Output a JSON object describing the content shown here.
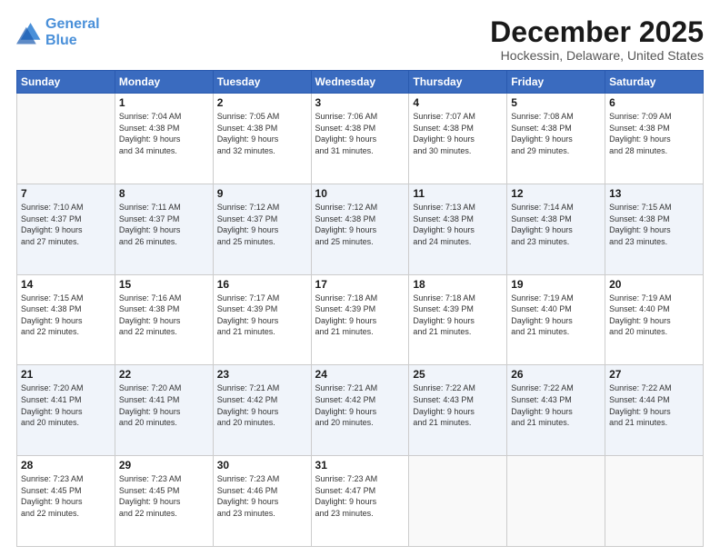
{
  "logo": {
    "line1": "General",
    "line2": "Blue"
  },
  "title": "December 2025",
  "subtitle": "Hockessin, Delaware, United States",
  "days_header": [
    "Sunday",
    "Monday",
    "Tuesday",
    "Wednesday",
    "Thursday",
    "Friday",
    "Saturday"
  ],
  "weeks": [
    [
      {
        "num": "",
        "info": ""
      },
      {
        "num": "1",
        "info": "Sunrise: 7:04 AM\nSunset: 4:38 PM\nDaylight: 9 hours\nand 34 minutes."
      },
      {
        "num": "2",
        "info": "Sunrise: 7:05 AM\nSunset: 4:38 PM\nDaylight: 9 hours\nand 32 minutes."
      },
      {
        "num": "3",
        "info": "Sunrise: 7:06 AM\nSunset: 4:38 PM\nDaylight: 9 hours\nand 31 minutes."
      },
      {
        "num": "4",
        "info": "Sunrise: 7:07 AM\nSunset: 4:38 PM\nDaylight: 9 hours\nand 30 minutes."
      },
      {
        "num": "5",
        "info": "Sunrise: 7:08 AM\nSunset: 4:38 PM\nDaylight: 9 hours\nand 29 minutes."
      },
      {
        "num": "6",
        "info": "Sunrise: 7:09 AM\nSunset: 4:38 PM\nDaylight: 9 hours\nand 28 minutes."
      }
    ],
    [
      {
        "num": "7",
        "info": "Sunrise: 7:10 AM\nSunset: 4:37 PM\nDaylight: 9 hours\nand 27 minutes."
      },
      {
        "num": "8",
        "info": "Sunrise: 7:11 AM\nSunset: 4:37 PM\nDaylight: 9 hours\nand 26 minutes."
      },
      {
        "num": "9",
        "info": "Sunrise: 7:12 AM\nSunset: 4:37 PM\nDaylight: 9 hours\nand 25 minutes."
      },
      {
        "num": "10",
        "info": "Sunrise: 7:12 AM\nSunset: 4:38 PM\nDaylight: 9 hours\nand 25 minutes."
      },
      {
        "num": "11",
        "info": "Sunrise: 7:13 AM\nSunset: 4:38 PM\nDaylight: 9 hours\nand 24 minutes."
      },
      {
        "num": "12",
        "info": "Sunrise: 7:14 AM\nSunset: 4:38 PM\nDaylight: 9 hours\nand 23 minutes."
      },
      {
        "num": "13",
        "info": "Sunrise: 7:15 AM\nSunset: 4:38 PM\nDaylight: 9 hours\nand 23 minutes."
      }
    ],
    [
      {
        "num": "14",
        "info": "Sunrise: 7:15 AM\nSunset: 4:38 PM\nDaylight: 9 hours\nand 22 minutes."
      },
      {
        "num": "15",
        "info": "Sunrise: 7:16 AM\nSunset: 4:38 PM\nDaylight: 9 hours\nand 22 minutes."
      },
      {
        "num": "16",
        "info": "Sunrise: 7:17 AM\nSunset: 4:39 PM\nDaylight: 9 hours\nand 21 minutes."
      },
      {
        "num": "17",
        "info": "Sunrise: 7:18 AM\nSunset: 4:39 PM\nDaylight: 9 hours\nand 21 minutes."
      },
      {
        "num": "18",
        "info": "Sunrise: 7:18 AM\nSunset: 4:39 PM\nDaylight: 9 hours\nand 21 minutes."
      },
      {
        "num": "19",
        "info": "Sunrise: 7:19 AM\nSunset: 4:40 PM\nDaylight: 9 hours\nand 21 minutes."
      },
      {
        "num": "20",
        "info": "Sunrise: 7:19 AM\nSunset: 4:40 PM\nDaylight: 9 hours\nand 20 minutes."
      }
    ],
    [
      {
        "num": "21",
        "info": "Sunrise: 7:20 AM\nSunset: 4:41 PM\nDaylight: 9 hours\nand 20 minutes."
      },
      {
        "num": "22",
        "info": "Sunrise: 7:20 AM\nSunset: 4:41 PM\nDaylight: 9 hours\nand 20 minutes."
      },
      {
        "num": "23",
        "info": "Sunrise: 7:21 AM\nSunset: 4:42 PM\nDaylight: 9 hours\nand 20 minutes."
      },
      {
        "num": "24",
        "info": "Sunrise: 7:21 AM\nSunset: 4:42 PM\nDaylight: 9 hours\nand 20 minutes."
      },
      {
        "num": "25",
        "info": "Sunrise: 7:22 AM\nSunset: 4:43 PM\nDaylight: 9 hours\nand 21 minutes."
      },
      {
        "num": "26",
        "info": "Sunrise: 7:22 AM\nSunset: 4:43 PM\nDaylight: 9 hours\nand 21 minutes."
      },
      {
        "num": "27",
        "info": "Sunrise: 7:22 AM\nSunset: 4:44 PM\nDaylight: 9 hours\nand 21 minutes."
      }
    ],
    [
      {
        "num": "28",
        "info": "Sunrise: 7:23 AM\nSunset: 4:45 PM\nDaylight: 9 hours\nand 22 minutes."
      },
      {
        "num": "29",
        "info": "Sunrise: 7:23 AM\nSunset: 4:45 PM\nDaylight: 9 hours\nand 22 minutes."
      },
      {
        "num": "30",
        "info": "Sunrise: 7:23 AM\nSunset: 4:46 PM\nDaylight: 9 hours\nand 23 minutes."
      },
      {
        "num": "31",
        "info": "Sunrise: 7:23 AM\nSunset: 4:47 PM\nDaylight: 9 hours\nand 23 minutes."
      },
      {
        "num": "",
        "info": ""
      },
      {
        "num": "",
        "info": ""
      },
      {
        "num": "",
        "info": ""
      }
    ]
  ]
}
